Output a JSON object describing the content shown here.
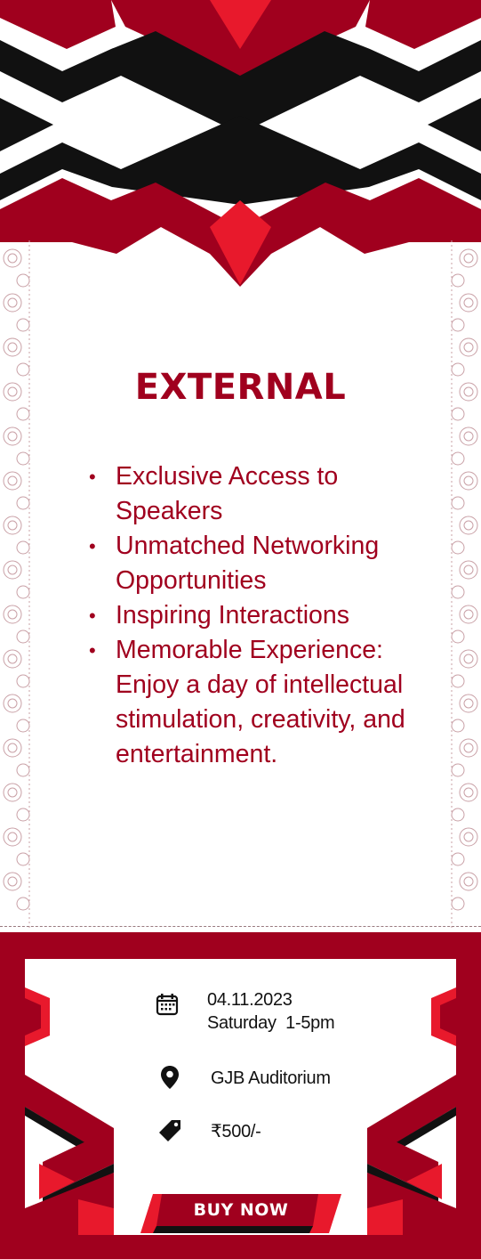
{
  "event": {
    "category": "EXTERNAL",
    "features": [
      "Exclusive Access to Speakers",
      "Unmatched Networking Opportunities",
      "Inspiring Interactions",
      "Memorable Experience: Enjoy a day of intellectual stimulation, creativity, and entertainment."
    ]
  },
  "ticket": {
    "date": "04.11.2023",
    "time": "Saturday  1-5pm",
    "venue": "GJB Auditorium",
    "price": "₹500/-",
    "buy_label": "BUY NOW",
    "icons": [
      "calendar-icon",
      "location-pin-icon",
      "price-tag-icon"
    ]
  },
  "colors": {
    "brand_red": "#a0001e",
    "accent_red": "#e8192c",
    "black": "#111111"
  }
}
